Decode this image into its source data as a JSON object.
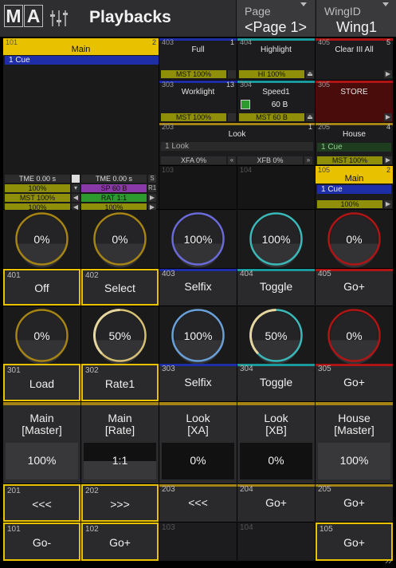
{
  "header": {
    "logo_m": "M",
    "logo_a": "A",
    "title": "Playbacks",
    "page_label": "Page",
    "page_value": "<Page 1>",
    "wing_label": "WingID",
    "wing_value": "Wing1"
  },
  "colors": {
    "yellow": "#e8c200",
    "blue": "#1d2ea8",
    "teal": "#1a9a9a",
    "red": "#b01515",
    "gold": "#a58314",
    "olive": "#8f8f0a",
    "purple": "#8a3aa8",
    "green": "#2c9a2c"
  },
  "main101": {
    "num": "101",
    "num_right": "2",
    "name": "Main",
    "cue": "1  Cue",
    "tme1": "TME 0.00 s",
    "tme2": "TME 0.00 s",
    "pct1": "100%",
    "sp": "SP 60 B",
    "mst": "MST 100%",
    "rat": "RAT 1:1",
    "pct2": "100%",
    "pct3": "100%",
    "r1": "R1"
  },
  "minis": {
    "c403": {
      "num": "403",
      "right": "1",
      "name": "Full",
      "bar": "MST 100%"
    },
    "c404": {
      "num": "404",
      "right": "",
      "name": "Highlight",
      "bar": "HI 100%"
    },
    "c405": {
      "num": "405",
      "right": "5",
      "name": "Clear III All"
    },
    "c303": {
      "num": "303",
      "right": "13",
      "name": "Worklight",
      "bar": "MST 100%"
    },
    "c304": {
      "num": "304",
      "right": "",
      "name": "Speed1",
      "speed": "60 B",
      "bar": "MST 60 B"
    },
    "c305": {
      "num": "305",
      "right": "",
      "name": "STORE"
    },
    "c203": {
      "num": "203",
      "right": "1",
      "name": "Look",
      "cue": "1  Look",
      "xfa": "XFA 0%",
      "xfb": "XFB 0%"
    },
    "c205": {
      "num": "205",
      "right": "4",
      "name": "House",
      "cue": "1  Cue",
      "bar": "MST 100%"
    },
    "c103": {
      "num": "103"
    },
    "c104": {
      "num": "104"
    },
    "c105": {
      "num": "105",
      "right": "2",
      "name": "Main",
      "cue": "1  Cue",
      "bar": "100%"
    }
  },
  "row4_dials": [
    "0%",
    "0%",
    "100%",
    "100%",
    "0%"
  ],
  "row4_dial_levels": [
    0,
    0,
    1,
    1,
    0
  ],
  "row4_buttons": [
    {
      "num": "401",
      "label": "Off"
    },
    {
      "num": "402",
      "label": "Select"
    },
    {
      "num": "403",
      "label": "Selfix"
    },
    {
      "num": "404",
      "label": "Toggle"
    },
    {
      "num": "405",
      "label": "Go+"
    }
  ],
  "row3_dials": [
    "0%",
    "50%",
    "100%",
    "50%",
    "0%"
  ],
  "row3_dial_levels": [
    0,
    0.5,
    1,
    0.5,
    0
  ],
  "row3_buttons": [
    {
      "num": "301",
      "label": "Load"
    },
    {
      "num": "302",
      "label": "Rate1"
    },
    {
      "num": "303",
      "label": "Selfix"
    },
    {
      "num": "304",
      "label": "Toggle"
    },
    {
      "num": "305",
      "label": "Go+"
    }
  ],
  "faders": [
    {
      "line1": "Main",
      "line2": "[Master]",
      "value": "100%",
      "level": 1
    },
    {
      "line1": "Main",
      "line2": "[Rate]",
      "value": "1:1",
      "level": 0.5
    },
    {
      "line1": "Look",
      "line2": "[XA]",
      "value": "0%",
      "level": 0
    },
    {
      "line1": "Look",
      "line2": "[XB]",
      "value": "0%",
      "level": 0
    },
    {
      "line1": "House",
      "line2": "[Master]",
      "value": "100%",
      "level": 1
    }
  ],
  "row2_buttons": [
    {
      "num": "201",
      "label": "<<<"
    },
    {
      "num": "202",
      "label": ">>>"
    },
    {
      "num": "203",
      "label": "<<<"
    },
    {
      "num": "204",
      "label": "Go+"
    },
    {
      "num": "205",
      "label": "Go+"
    }
  ],
  "row1_buttons": [
    {
      "num": "101",
      "label": "Go-"
    },
    {
      "num": "102",
      "label": "Go+"
    },
    {
      "num": "103",
      "label": ""
    },
    {
      "num": "104",
      "label": ""
    },
    {
      "num": "105",
      "label": "Go+"
    }
  ]
}
